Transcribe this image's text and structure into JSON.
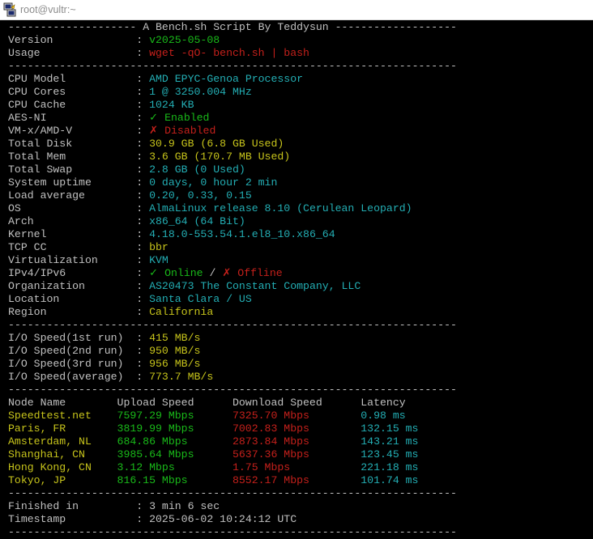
{
  "window": {
    "title": "root@vultr:~"
  },
  "header": {
    "line": "-------------------- A Bench.sh Script By Teddysun -------------------"
  },
  "info": [
    {
      "label": "Version             ",
      "value": [
        {
          "t": "v2025-05-08",
          "c": "green"
        }
      ]
    },
    {
      "label": "Usage               ",
      "value": [
        {
          "t": "wget -qO- bench.sh | bash",
          "c": "red"
        }
      ]
    }
  ],
  "separator": "----------------------------------------------------------------------",
  "system": [
    {
      "label": "CPU Model           ",
      "value": [
        {
          "t": "AMD EPYC-Genoa Processor",
          "c": "cyan"
        }
      ]
    },
    {
      "label": "CPU Cores           ",
      "value": [
        {
          "t": "1 @ 3250.004 MHz",
          "c": "cyan"
        }
      ]
    },
    {
      "label": "CPU Cache           ",
      "value": [
        {
          "t": "1024 KB",
          "c": "cyan"
        }
      ]
    },
    {
      "label": "AES-NI              ",
      "value": [
        {
          "t": "✓ Enabled",
          "c": "green"
        }
      ]
    },
    {
      "label": "VM-x/AMD-V          ",
      "value": [
        {
          "t": "✗ Disabled",
          "c": "red"
        }
      ]
    },
    {
      "label": "Total Disk          ",
      "value": [
        {
          "t": "30.9 GB (6.8 GB Used)",
          "c": "yellow"
        }
      ]
    },
    {
      "label": "Total Mem           ",
      "value": [
        {
          "t": "3.6 GB (170.7 MB Used)",
          "c": "yellow"
        }
      ]
    },
    {
      "label": "Total Swap          ",
      "value": [
        {
          "t": "2.8 GB (0 Used)",
          "c": "cyan"
        }
      ]
    },
    {
      "label": "System uptime       ",
      "value": [
        {
          "t": "0 days, 0 hour 2 min",
          "c": "cyan"
        }
      ]
    },
    {
      "label": "Load average        ",
      "value": [
        {
          "t": "0.20, 0.33, 0.15",
          "c": "cyan"
        }
      ]
    },
    {
      "label": "OS                  ",
      "value": [
        {
          "t": "AlmaLinux release 8.10 (Cerulean Leopard)",
          "c": "cyan"
        }
      ]
    },
    {
      "label": "Arch                ",
      "value": [
        {
          "t": "x86_64 (64 Bit)",
          "c": "cyan"
        }
      ]
    },
    {
      "label": "Kernel              ",
      "value": [
        {
          "t": "4.18.0-553.54.1.el8_10.x86_64",
          "c": "cyan"
        }
      ]
    },
    {
      "label": "TCP CC              ",
      "value": [
        {
          "t": "bbr",
          "c": "yellow"
        }
      ]
    },
    {
      "label": "Virtualization      ",
      "value": [
        {
          "t": "KVM",
          "c": "cyan"
        }
      ]
    },
    {
      "label": "IPv4/IPv6           ",
      "value": [
        {
          "t": "✓ Online",
          "c": "green"
        },
        {
          "t": " / ",
          "c": "gray"
        },
        {
          "t": "✗ Offline",
          "c": "red"
        }
      ]
    },
    {
      "label": "Organization        ",
      "value": [
        {
          "t": "AS20473 The Constant Company, LLC",
          "c": "cyan"
        }
      ]
    },
    {
      "label": "Location            ",
      "value": [
        {
          "t": "Santa Clara / US",
          "c": "cyan"
        }
      ]
    },
    {
      "label": "Region              ",
      "value": [
        {
          "t": "California",
          "c": "yellow"
        }
      ]
    }
  ],
  "io": [
    {
      "label": "I/O Speed(1st run)  ",
      "value": [
        {
          "t": "415 MB/s",
          "c": "yellow"
        }
      ]
    },
    {
      "label": "I/O Speed(2nd run)  ",
      "value": [
        {
          "t": "950 MB/s",
          "c": "yellow"
        }
      ]
    },
    {
      "label": "I/O Speed(3rd run)  ",
      "value": [
        {
          "t": "956 MB/s",
          "c": "yellow"
        }
      ]
    },
    {
      "label": "I/O Speed(average)  ",
      "value": [
        {
          "t": "773.7 MB/s",
          "c": "yellow"
        }
      ]
    }
  ],
  "speedtest": {
    "headers": [
      "Node Name",
      "Upload Speed",
      "Download Speed",
      "Latency"
    ],
    "rows": [
      [
        "Speedtest.net",
        "7597.29 Mbps",
        "7325.70 Mbps",
        "0.98 ms"
      ],
      [
        "Paris, FR",
        "3819.99 Mbps",
        "7002.83 Mbps",
        "132.15 ms"
      ],
      [
        "Amsterdam, NL",
        "684.86 Mbps",
        "2873.84 Mbps",
        "143.21 ms"
      ],
      [
        "Shanghai, CN",
        "3985.64 Mbps",
        "5637.36 Mbps",
        "123.45 ms"
      ],
      [
        "Hong Kong, CN",
        "3.12 Mbps",
        "1.75 Mbps",
        "221.18 ms"
      ],
      [
        "Tokyo, JP",
        "816.15 Mbps",
        "8552.17 Mbps",
        "101.74 ms"
      ]
    ]
  },
  "footer": [
    {
      "label": "Finished in         ",
      "value": [
        {
          "t": "3 min 6 sec",
          "c": "gray"
        }
      ]
    },
    {
      "label": "Timestamp           ",
      "value": [
        {
          "t": "2025-06-02 10:24:12 UTC",
          "c": "gray"
        }
      ]
    }
  ],
  "colors": {
    "green": "#19b919",
    "yellow": "#c7c41b",
    "cyan": "#23aeb4",
    "red": "#c5201b",
    "gray": "#c0c0c0"
  }
}
